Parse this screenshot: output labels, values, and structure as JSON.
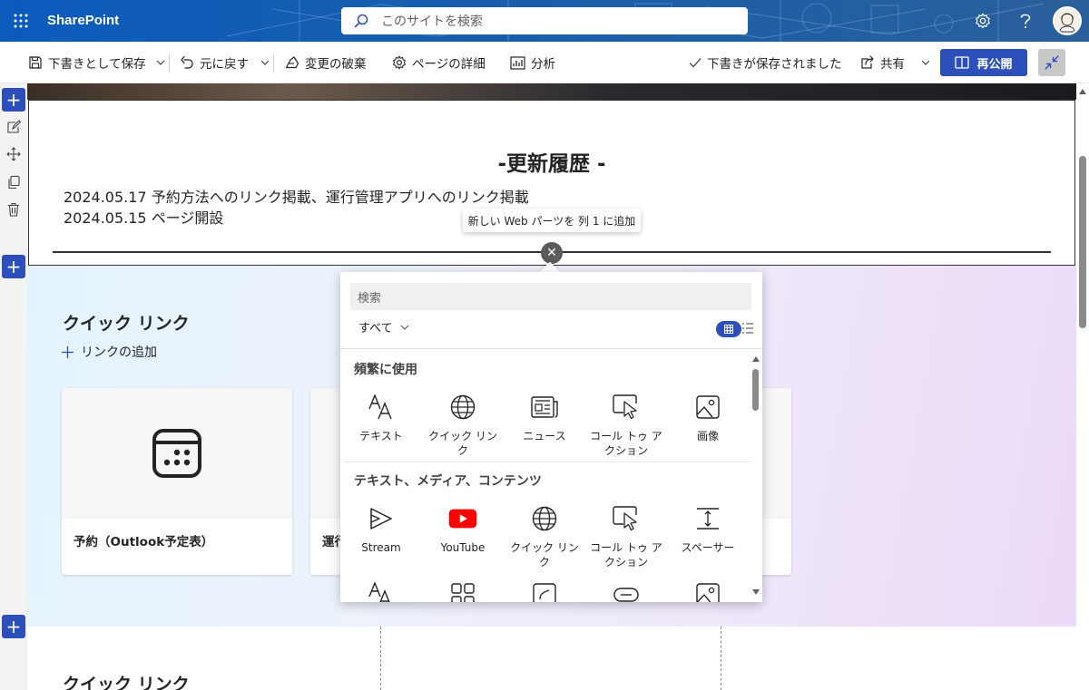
{
  "suite_bar": {
    "app_name": "SharePoint",
    "search_placeholder": "このサイトを検索",
    "icons": [
      "waffle-icon",
      "search-icon",
      "settings-icon",
      "help-icon",
      "avatar"
    ],
    "accent_color": "#0f5eb8"
  },
  "command_bar": {
    "save_draft": "下書きとして保存",
    "undo": "元に戻す",
    "discard": "変更の破棄",
    "page_details": "ページの詳細",
    "analytics": "分析",
    "saved_status": "下書きが保存されました",
    "share": "共有",
    "republish": "再公開",
    "republish_color": "#2c4fb9"
  },
  "history": {
    "title": "-更新履歴 -",
    "lines": [
      "2024.05.17 予約方法へのリンク掲載、運行管理アプリへのリンク掲載",
      "2024.05.15 ページ開設"
    ]
  },
  "add_webpart": {
    "tooltip": "新しい Web パーツを 列 1 に追加",
    "close_symbol": "✕"
  },
  "quick_links": {
    "title": "クイック リンク",
    "add_link": "リンクの追加",
    "cards": [
      {
        "label": "予約（Outlook予定表）",
        "icon": "calendar-icon"
      },
      {
        "label": "運行",
        "icon": ""
      }
    ]
  },
  "quick_links_2": {
    "title": "クイック リンク"
  },
  "toolbox": {
    "search_placeholder": "検索",
    "filter": "すべて",
    "categories": [
      {
        "title": "頻繁に使用",
        "items": [
          {
            "name": "テキスト",
            "icon": "text-icon"
          },
          {
            "name": "クイック リンク",
            "icon": "globe-icon"
          },
          {
            "name": "ニュース",
            "icon": "news-icon"
          },
          {
            "name": "コール トゥ アクション",
            "icon": "call-to-action-icon"
          },
          {
            "name": "画像",
            "icon": "image-icon"
          }
        ]
      },
      {
        "title": "テキスト、メディア、コンテンツ",
        "items": [
          {
            "name": "Stream",
            "icon": "stream-icon"
          },
          {
            "name": "YouTube",
            "icon": "youtube-icon"
          },
          {
            "name": "クイック リンク",
            "icon": "globe-icon"
          },
          {
            "name": "コール トゥ アクション",
            "icon": "call-to-action-icon"
          },
          {
            "name": "スペーサー",
            "icon": "spacer-icon"
          }
        ]
      }
    ],
    "youtube_color": "#ff0000"
  }
}
